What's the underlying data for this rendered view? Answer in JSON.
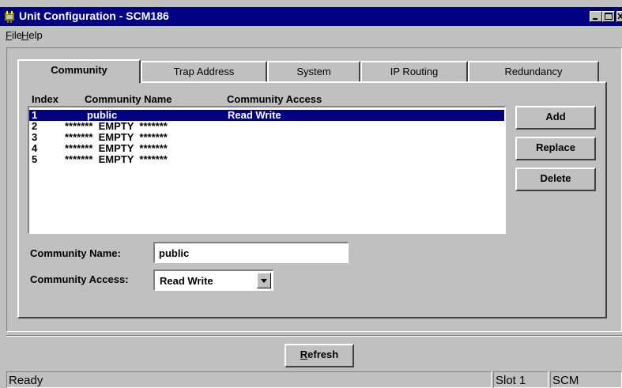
{
  "window": {
    "title": "Unit Configuration - SCM186"
  },
  "menu": {
    "file": {
      "accel": "F",
      "rest": "ile"
    },
    "help": {
      "accel": "H",
      "rest": "elp"
    }
  },
  "tabs": [
    {
      "label": "Community",
      "active": true
    },
    {
      "label": "Trap Address",
      "active": false
    },
    {
      "label": "System",
      "active": false
    },
    {
      "label": "IP Routing",
      "active": false
    },
    {
      "label": "Redundancy",
      "active": false
    }
  ],
  "list": {
    "headers": {
      "index": "Index",
      "name": "Community Name",
      "access": "Community Access"
    },
    "rows": [
      {
        "index": "1",
        "name": "public",
        "access": "Read Write",
        "selected": true
      },
      {
        "index": "2",
        "name": "*******  EMPTY  *******",
        "access": "",
        "selected": false
      },
      {
        "index": "3",
        "name": "*******  EMPTY  *******",
        "access": "",
        "selected": false
      },
      {
        "index": "4",
        "name": "*******  EMPTY  *******",
        "access": "",
        "selected": false
      },
      {
        "index": "5",
        "name": "*******  EMPTY  *******",
        "access": "",
        "selected": false
      }
    ]
  },
  "buttons": {
    "add": "Add",
    "replace": "Replace",
    "delete": "Delete",
    "refresh_accel": "R",
    "refresh_rest": "efresh"
  },
  "form": {
    "name_label": "Community Name:",
    "name_value": "public",
    "access_label": "Community Access:",
    "access_value": "Read Write"
  },
  "status": {
    "message": "Ready",
    "slot": "Slot 1",
    "module": "SCM"
  },
  "icons": {
    "app": "app-icon",
    "dropdown": "chevron-down-icon"
  },
  "colors": {
    "titlebar": "#000080",
    "selection": "#000080",
    "face": "#c0c0c0"
  }
}
